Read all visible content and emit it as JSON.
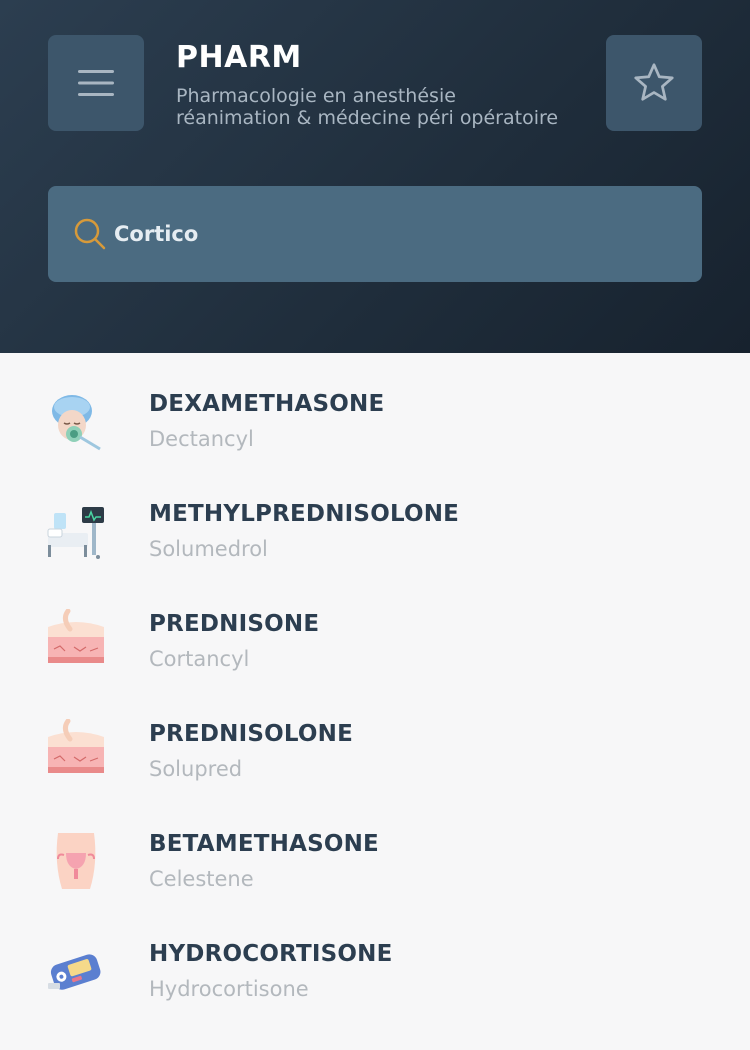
{
  "header": {
    "title": "PHARM",
    "subtitle_line1": "Pharmacologie en anesthésie",
    "subtitle_line2": "réanimation & médecine péri opératoire"
  },
  "search": {
    "value": "Cortico"
  },
  "drugs": [
    {
      "name": "DEXAMETHASONE",
      "brand": "Dectancyl",
      "icon": "patient-mask-icon"
    },
    {
      "name": "METHYLPREDNISOLONE",
      "brand": "Solumedrol",
      "icon": "hospital-bed-icon"
    },
    {
      "name": "PREDNISONE",
      "brand": "Cortancyl",
      "icon": "skin-layer-icon"
    },
    {
      "name": "PREDNISOLONE",
      "brand": "Solupred",
      "icon": "skin-layer-icon"
    },
    {
      "name": "BETAMETHASONE",
      "brand": "Celestene",
      "icon": "uterus-icon"
    },
    {
      "name": "HYDROCORTISONE",
      "brand": "Hydrocortisone",
      "icon": "glucometer-icon"
    }
  ],
  "colors": {
    "header_bg": "#2c3e50",
    "button_bg": "#3d566b",
    "search_bg": "#4b6b81",
    "search_icon": "#d79a3a",
    "item_title": "#2c3e50",
    "item_subtitle": "#b3b8bd"
  }
}
